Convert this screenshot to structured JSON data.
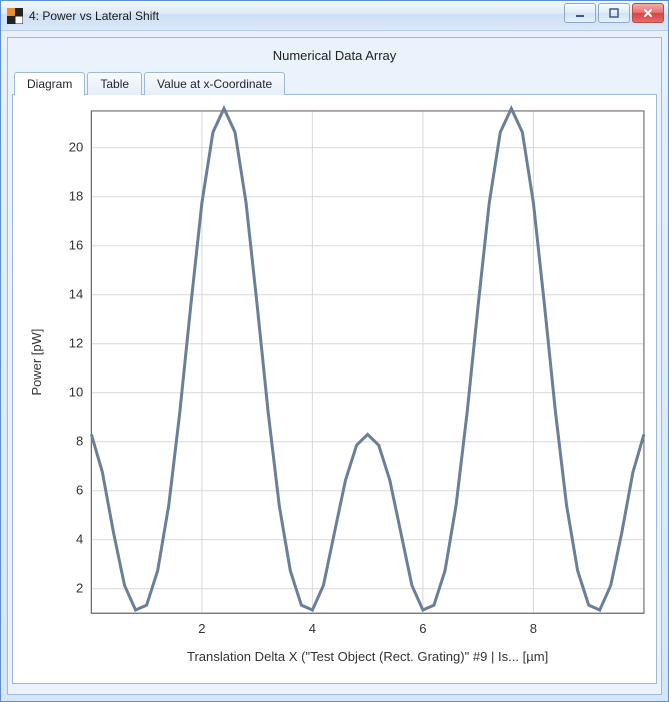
{
  "window": {
    "title": "4: Power vs Lateral Shift"
  },
  "panel": {
    "subtitle": "Numerical Data Array"
  },
  "tabs": {
    "items": [
      {
        "label": "Diagram"
      },
      {
        "label": "Table"
      },
      {
        "label": "Value at x-Coordinate"
      }
    ],
    "active_index": 0
  },
  "chart_data": {
    "type": "line",
    "title": "",
    "xlabel": "Translation Delta X (\"Test Object (Rect. Grating)\" #9 | Is... [µm]",
    "ylabel": "Power [pW]",
    "xlim": [
      0,
      10
    ],
    "ylim": [
      1,
      21.5
    ],
    "x_ticks": [
      2,
      4,
      6,
      8
    ],
    "y_ticks": [
      2,
      4,
      6,
      8,
      10,
      12,
      14,
      16,
      18,
      20
    ],
    "grid": true,
    "x": [
      0.0,
      0.2,
      0.4,
      0.6,
      0.8,
      1.0,
      1.2,
      1.4,
      1.6,
      1.8,
      2.0,
      2.2,
      2.4,
      2.6,
      2.8,
      3.0,
      3.2,
      3.4,
      3.6,
      3.8,
      4.0,
      4.2,
      4.4,
      4.6,
      4.8,
      5.0,
      5.2,
      5.4,
      5.6,
      5.8,
      6.0,
      6.2,
      6.4,
      6.6,
      6.8,
      7.0,
      7.2,
      7.4,
      7.6,
      7.8,
      8.0,
      8.2,
      8.4,
      8.6,
      8.8,
      9.0,
      9.2,
      9.4,
      9.6,
      9.8,
      10.0
    ],
    "values": [
      8.3,
      6.75,
      4.3,
      2.14,
      1.13,
      1.33,
      2.74,
      5.4,
      9.19,
      13.58,
      17.74,
      20.63,
      21.6,
      20.63,
      17.74,
      13.58,
      9.19,
      5.4,
      2.74,
      1.33,
      1.13,
      2.14,
      4.3,
      6.44,
      7.86,
      8.3,
      7.86,
      6.44,
      4.3,
      2.14,
      1.13,
      1.33,
      2.74,
      5.4,
      9.19,
      13.58,
      17.74,
      20.63,
      21.6,
      20.63,
      17.74,
      13.58,
      9.19,
      5.4,
      2.74,
      1.33,
      1.13,
      2.14,
      4.3,
      6.75,
      8.3
    ]
  },
  "colors": {
    "curve": "#6b7f96",
    "grid": "#d8d8d8",
    "axis": "#666666"
  }
}
